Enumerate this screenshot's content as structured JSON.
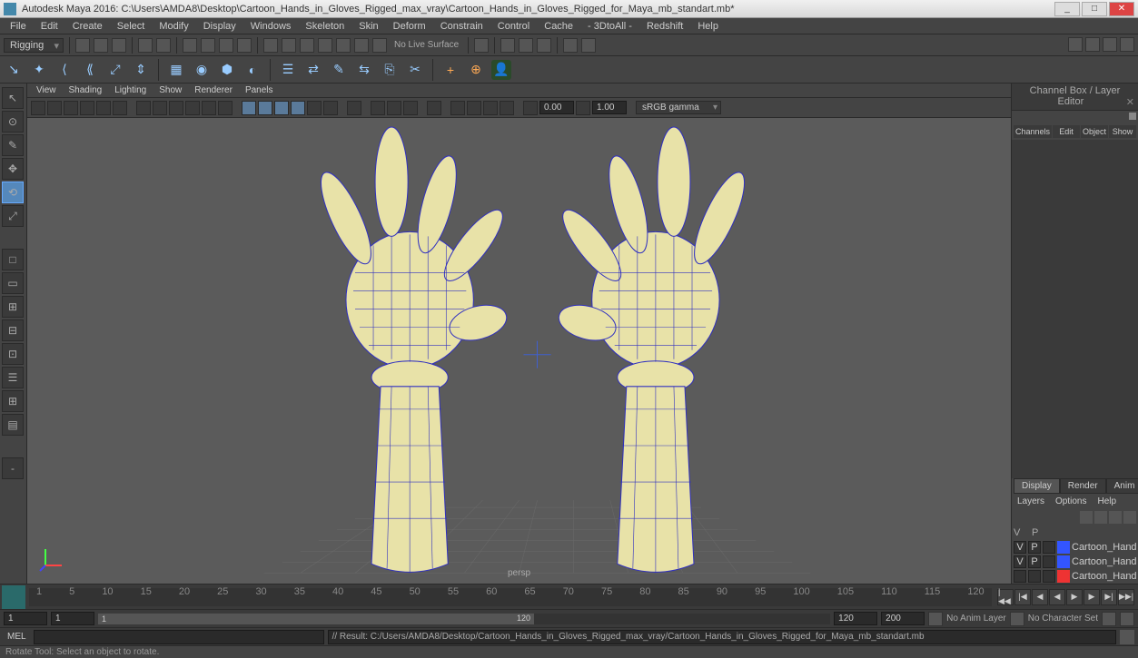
{
  "title": "Autodesk Maya 2016: C:\\Users\\AMDA8\\Desktop\\Cartoon_Hands_in_Gloves_Rigged_max_vray\\Cartoon_Hands_in_Gloves_Rigged_for_Maya_mb_standart.mb*",
  "menubar": [
    "File",
    "Edit",
    "Create",
    "Select",
    "Modify",
    "Display",
    "Windows",
    "Skeleton",
    "Skin",
    "Deform",
    "Constrain",
    "Control",
    "Cache",
    "- 3DtoAll -",
    "Redshift",
    "Help"
  ],
  "shelf": {
    "mode": "Rigging",
    "no_live": "No Live Surface"
  },
  "viewport_menus": [
    "View",
    "Shading",
    "Lighting",
    "Show",
    "Renderer",
    "Panels"
  ],
  "viewport": {
    "near": "0.00",
    "far": "1.00",
    "colorspace": "sRGB gamma",
    "camera": "persp"
  },
  "channelbox": {
    "title": "Channel Box / Layer Editor",
    "tabs": [
      "Channels",
      "Edit",
      "Object",
      "Show"
    ],
    "tabs2": [
      "Display",
      "Render",
      "Anim"
    ],
    "layer_menus": [
      "Layers",
      "Options",
      "Help"
    ],
    "header": {
      "v": "V",
      "p": "P"
    }
  },
  "layers": [
    {
      "v": "V",
      "p": "P",
      "color": "#3355ff",
      "name": "Cartoon_Hands_in_Glo..."
    },
    {
      "v": "V",
      "p": "P",
      "color": "#3355ff",
      "name": "Cartoon_Hands_bone..."
    },
    {
      "v": "",
      "p": "",
      "color": "#ee3333",
      "name": "Cartoon_Hands_contr..."
    }
  ],
  "timeline": {
    "ticks": [
      "1",
      "5",
      "10",
      "15",
      "20",
      "25",
      "30",
      "35",
      "40",
      "45",
      "50",
      "55",
      "60",
      "65",
      "70",
      "75",
      "80",
      "85",
      "90",
      "95",
      "100",
      "105",
      "110",
      "115",
      "120"
    ]
  },
  "range": {
    "start": "1",
    "innerStart": "1",
    "current": "1",
    "innerEnd": "120",
    "end": "120",
    "fps": "200",
    "anim_layer": "No Anim Layer",
    "char_set": "No Character Set"
  },
  "cmd": {
    "lang": "MEL",
    "result": "// Result: C:/Users/AMDA8/Desktop/Cartoon_Hands_in_Gloves_Rigged_max_vray/Cartoon_Hands_in_Gloves_Rigged_for_Maya_mb_standart.mb"
  },
  "help": "Rotate Tool: Select an object to rotate."
}
